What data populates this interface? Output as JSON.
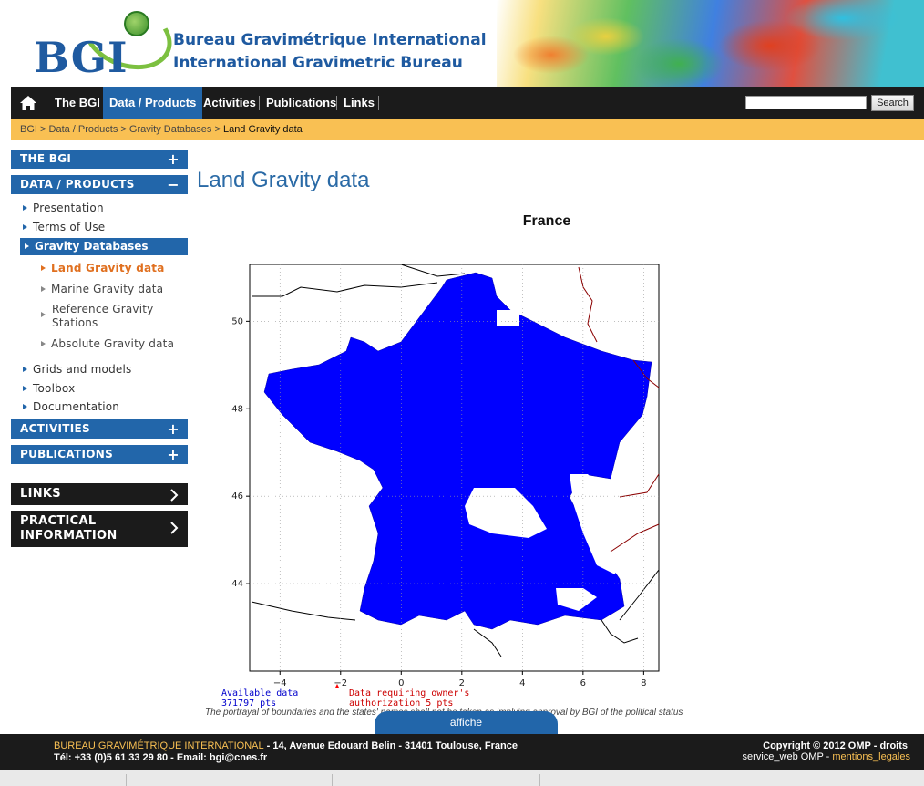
{
  "header": {
    "logo_text": "BGI",
    "title_fr": "Bureau Gravimétrique International",
    "title_en": "International Gravimetric Bureau"
  },
  "nav": {
    "items": [
      "The BGI",
      "Data / Products",
      "Activities",
      "Publications",
      "Links"
    ],
    "active": "Data / Products",
    "search_button": "Search",
    "search_value": ""
  },
  "breadcrumb": {
    "items": [
      "BGI",
      "Data / Products",
      "Gravity Databases"
    ],
    "current": "Land Gravity data",
    "separator": ">"
  },
  "sidebar": {
    "the_bgi": "THE BGI",
    "data_products": "DATA / PRODUCTS",
    "presentation": "Presentation",
    "terms": "Terms of Use",
    "gravity_databases": "Gravity Databases",
    "land": "Land Gravity data",
    "marine": "Marine Gravity data",
    "reference_1": "Reference Gravity",
    "reference_2": "Stations",
    "absolute": "Absolute Gravity data",
    "grids": "Grids and models",
    "toolbox": "Toolbox",
    "documentation": "Documentation",
    "activities": "ACTIVITIES",
    "publications": "PUBLICATIONS",
    "links": "LINKS",
    "practical_1": "PRACTICAL",
    "practical_2": "INFORMATION",
    "plus": "+",
    "minus": "−",
    "chevron": "›"
  },
  "main": {
    "title": "Land Gravity data",
    "map_title": "France",
    "legend_available_1": "Available data",
    "legend_available_2": "371797 pts",
    "legend_owner_1": "Data requiring owner's",
    "legend_owner_2": "authorization 5 pts",
    "disclaimer": "The portrayal of boundaries and the states' names shall not be taken as implying approval by BGI of the political status",
    "affiche_button": "affiche"
  },
  "chart_data": {
    "type": "scatter",
    "title": "France",
    "x_ticks": [
      -4,
      -2,
      0,
      2,
      4,
      6,
      8
    ],
    "y_ticks": [
      44,
      46,
      48,
      50
    ],
    "xlim": [
      -5,
      8.5
    ],
    "ylim": [
      42,
      51.3
    ],
    "series": [
      {
        "name": "Available data",
        "count_label": "371797 pts",
        "color": "#0000ff"
      },
      {
        "name": "Data requiring owner's authorization",
        "count_label": "5 pts",
        "color": "#ff0000"
      }
    ],
    "grid": true,
    "legend_position": "bottom-left"
  },
  "footer": {
    "org": "BUREAU GRAVIMÉTRIQUE INTERNATIONAL",
    "address": " - 14, Avenue Edouard Belin - 31401 Toulouse, France",
    "phone": "Tél: +33 (0)5 61 33 29 80 - Email: ",
    "email": "bgi@cnes.fr",
    "copyright": "Copyright © 2012 OMP - droits",
    "service": "service_web OMP - ",
    "mentions": "mentions_legales"
  },
  "colors": {
    "primary": "#2266aa",
    "accent": "#f9c053",
    "nav_bg": "#1b1b1b",
    "data_blue": "#0000ff",
    "data_red": "#ff0000"
  }
}
